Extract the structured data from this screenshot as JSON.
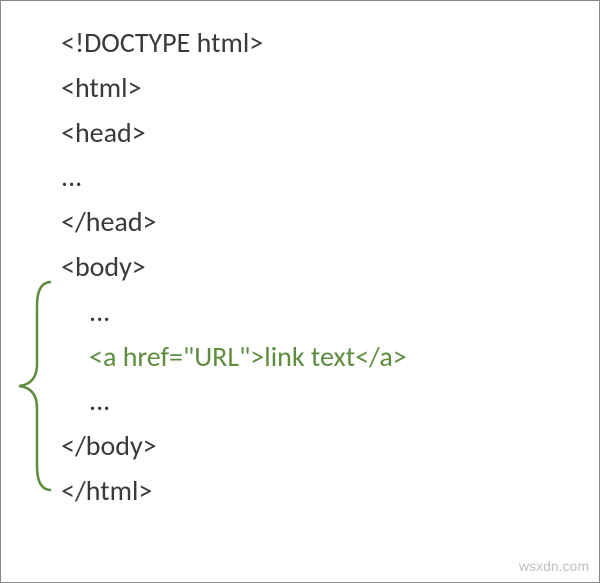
{
  "code": {
    "line1": "<!DOCTYPE html>",
    "line2": "<html>",
    "line3": "<head>",
    "line4": "...",
    "line5": "</head>",
    "line6": "<body>",
    "line7": "...",
    "line8": "<a href=\"URL\">link text</a>",
    "line9": "...",
    "line10": "</body>",
    "line11": "</html>"
  },
  "colors": {
    "highlight": "#5f8d3f",
    "text": "#3a3a3a",
    "brace": "#5f8d3f"
  },
  "watermark": "wsxdn.com"
}
